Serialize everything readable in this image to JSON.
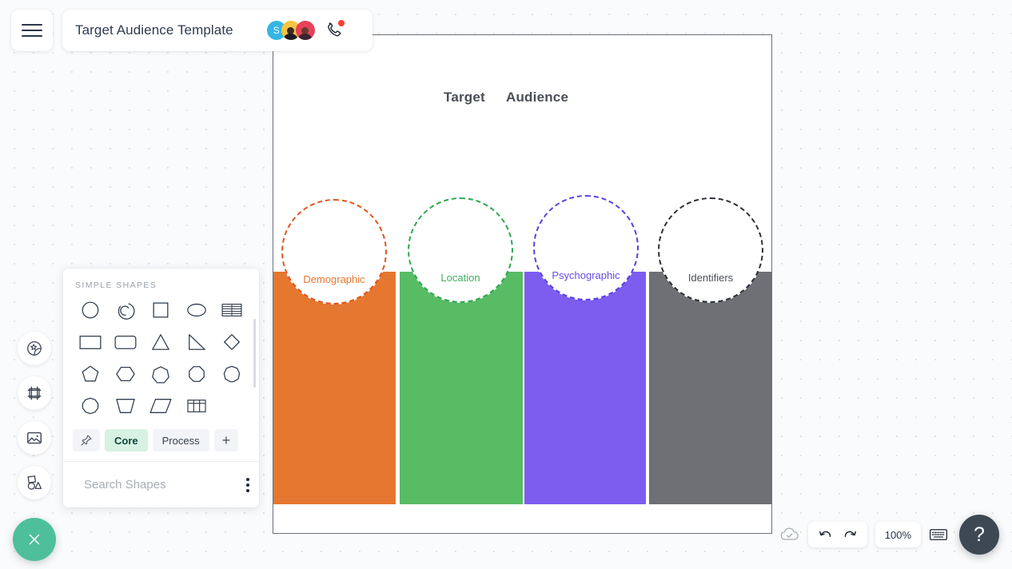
{
  "header": {
    "menu_icon": "hamburger-menu-icon",
    "document_title": "Target Audience Template",
    "avatars": [
      {
        "name": "avatar-s",
        "initial": "S",
        "color": "#34b6e6"
      },
      {
        "name": "avatar-yellow",
        "initial": "",
        "color": "#f6c343"
      },
      {
        "name": "avatar-red",
        "initial": "",
        "color": "#e8415a"
      }
    ],
    "call_icon": "phone-call-icon",
    "call_badge_color": "#ff3b30"
  },
  "canvas": {
    "title_part_1": "Target",
    "title_part_2": "Audience",
    "border_color": "#6b7079",
    "background": "#ffffff"
  },
  "chart_data": {
    "type": "bar",
    "title": "Target Audience",
    "categories": [
      "Demographic",
      "Location",
      "Psychographic",
      "Identifiers"
    ],
    "values": [
      100,
      100,
      100,
      100
    ],
    "xlabel": "",
    "ylabel": "",
    "legend": "none",
    "grid": false,
    "series": [
      {
        "name": "Target Audience",
        "values": [
          100,
          100,
          100,
          100
        ]
      }
    ],
    "colors": [
      "#e57730",
      "#58bc65",
      "#7d5cf0",
      "#6e7076"
    ],
    "label_colors": [
      "#e57730",
      "#3fae5f",
      "#6a4ae0",
      "#4a4f57"
    ],
    "circle_border_colors": [
      "#e0561d",
      "#2fa84f",
      "#5b3fe0",
      "#2c3038"
    ],
    "circle_labels": [
      "Demographic",
      "Location",
      "Psychographic",
      "Identifiers"
    ]
  },
  "rail": {
    "items": [
      {
        "name": "sticker-icon",
        "label": "Stickers"
      },
      {
        "name": "frame-icon",
        "label": "Frames"
      },
      {
        "name": "image-icon",
        "label": "Images"
      },
      {
        "name": "shapes-icon",
        "label": "Shapes"
      }
    ]
  },
  "shapes_panel": {
    "section_title": "Simple Shapes",
    "shapes": [
      {
        "name": "circle-shape",
        "label": "Circle"
      },
      {
        "name": "arc-shape",
        "label": "Arc"
      },
      {
        "name": "square-shape",
        "label": "Square"
      },
      {
        "name": "ellipse-shape",
        "label": "Ellipse"
      },
      {
        "name": "striped-table-shape",
        "label": "Striped Table"
      },
      {
        "name": "rectangle-shape",
        "label": "Rectangle"
      },
      {
        "name": "rounded-rectangle-shape",
        "label": "Rounded Rectangle"
      },
      {
        "name": "triangle-shape",
        "label": "Triangle"
      },
      {
        "name": "right-triangle-shape",
        "label": "Right Triangle"
      },
      {
        "name": "diamond-shape",
        "label": "Diamond"
      },
      {
        "name": "pentagon-shape",
        "label": "Pentagon"
      },
      {
        "name": "hexagon-shape",
        "label": "Hexagon"
      },
      {
        "name": "heptagon-shape",
        "label": "Heptagon"
      },
      {
        "name": "octagon-shape",
        "label": "Octagon"
      },
      {
        "name": "nonagon-shape",
        "label": "Nonagon"
      },
      {
        "name": "decagon-shape",
        "label": "Decagon"
      },
      {
        "name": "trapezoid-shape",
        "label": "Trapezoid"
      },
      {
        "name": "parallelogram-shape",
        "label": "Parallelogram"
      },
      {
        "name": "table-shape",
        "label": "Table"
      }
    ],
    "tabs": [
      {
        "name": "pin-tab",
        "label": "",
        "icon": "pin-icon",
        "active": false
      },
      {
        "name": "core-tab",
        "label": "Core",
        "active": true
      },
      {
        "name": "process-tab",
        "label": "Process",
        "active": false
      },
      {
        "name": "add-tab",
        "label": "+",
        "active": false
      }
    ],
    "active_tab_color": "#d7f2e3",
    "search_placeholder": "Search Shapes",
    "search_value": "",
    "search_icon": "search-icon",
    "more_icon": "kebab-menu-icon"
  },
  "close_fab": {
    "icon": "close-icon",
    "color": "#4ebf9b"
  },
  "bottom_bar": {
    "save_status_icon": "cloud-check-icon",
    "undo_icon": "undo-icon",
    "redo_icon": "redo-icon",
    "zoom_level": "100%",
    "keyboard_icon": "keyboard-icon",
    "help_label": "?"
  }
}
